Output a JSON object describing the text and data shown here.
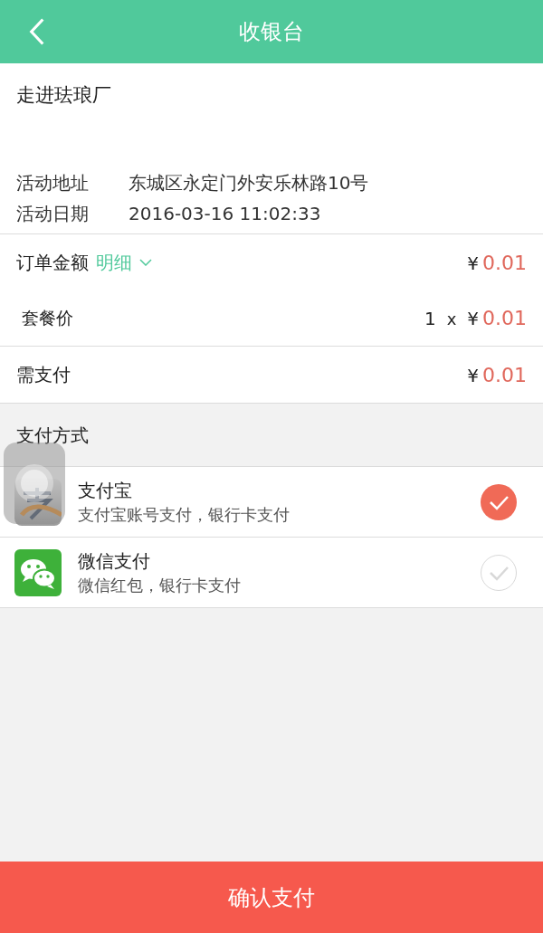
{
  "header": {
    "title": "收银台"
  },
  "event": {
    "title": "走进珐琅厂",
    "fields": [
      {
        "label": "活动地址",
        "value": "东城区永定门外安乐林路10号"
      },
      {
        "label": "活动日期",
        "value": "2016-03-16 11:02:33"
      }
    ]
  },
  "order": {
    "label": "订单金额",
    "detail_link": "明细",
    "currency": "¥",
    "amount": "0.01",
    "items": [
      {
        "name": "套餐价",
        "quantity": "1",
        "times": "x",
        "currency": "¥",
        "price": "0.01"
      }
    ]
  },
  "payable": {
    "label": "需支付",
    "currency": "¥",
    "amount": "0.01"
  },
  "payment": {
    "heading": "支付方式",
    "methods": [
      {
        "kind": "alipay",
        "name": "支付宝",
        "description": "支付宝账号支付，银行卡支付",
        "selected": true
      },
      {
        "kind": "wechat",
        "name": "微信支付",
        "description": "微信红包，银行卡支付",
        "selected": false
      }
    ]
  },
  "confirm_button": "确认支付"
}
